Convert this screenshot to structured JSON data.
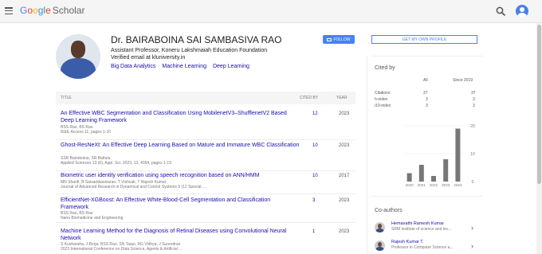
{
  "header": {
    "logo_letters": [
      "G",
      "o",
      "o",
      "g",
      "l",
      "e"
    ],
    "logo_product": "Scholar"
  },
  "profile": {
    "name": "Dr. BAIRABOINA SAI SAMBASIVA RAO",
    "affiliation": "Assistant Professor, Koneru Lakshmaiah Education Foundation",
    "email": "Verified email at kluniversity.in",
    "interests": [
      "Big Data Analytics",
      "Machine Learning",
      "Deep Learning"
    ],
    "follow_label": "FOLLOW",
    "my_profile_label": "GET MY OWN PROFILE"
  },
  "table": {
    "headers": {
      "title": "TITLE",
      "cited_by": "CITED BY",
      "year": "YEAR"
    },
    "rows": [
      {
        "title": "An Effective WBC Segmentation and Classification Using MobilenetV3–ShufflenetV2 Based Deep Learning Framework",
        "authors": "BSS Rao, BS Rao",
        "venue": "IEEE Access 11, pages 1-10",
        "cited": "12",
        "year": "2023"
      },
      {
        "title": "Ghost-ResNeXt: An Effective Deep Learning Based on Mature and Immature WBC Classification",
        "authors": "SSR Bairaboina, SR Battula",
        "venue": "Applied Sciences 13 (6), Appl. Sci. 2023, 13, 4054, pages 1-19",
        "cited": "10",
        "year": "2023"
      },
      {
        "title": "Biometric user identity verification using speech recognition based on ANN/HMM",
        "authors": "MN Sharifi, B Saisambasivarao, T Vishvak, T Rajesh Kumar",
        "venue": "Journal of Advanced Research in Dynamical and Control Systems 9 (12 Special ...",
        "cited": "10",
        "year": "2017"
      },
      {
        "title": "EfficientNet-XGBoost: An Effective White-Blood-Cell Segmentation and Classification Framework",
        "authors": "BSS Rao, BS Rao",
        "venue": "Nano Biomedicine and Engineering",
        "cited": "3",
        "year": "2023"
      },
      {
        "title": "Machine Learning Method for the Diagnosis of Retinal Diseases using Convolutional Neural Network",
        "authors": "S Kusharaha, J Borja, BSS Rao, SN Taqui, RG Vidhya, J Surendran",
        "venue": "2023 International Conference on Data Science, Agents & Artificial ...",
        "cited": "1",
        "year": "2023"
      }
    ]
  },
  "cited_by": {
    "title": "Cited by",
    "col_all": "All",
    "col_since": "Since 2019",
    "rows": [
      {
        "label": "Citations",
        "all": "37",
        "since": "37"
      },
      {
        "label": "h-index",
        "all": "3",
        "since": "3"
      },
      {
        "label": "i10-index",
        "all": "3",
        "since": "3"
      }
    ]
  },
  "chart_data": {
    "type": "bar",
    "categories": [
      "2020",
      "2021",
      "2022",
      "2023",
      "2024"
    ],
    "values": [
      3,
      6,
      2,
      8,
      19
    ],
    "yticks": [
      "20",
      "10",
      "0"
    ],
    "ylim": [
      0,
      20
    ],
    "bar_color": "#777777"
  },
  "coauthors": {
    "title": "Co-authors",
    "items": [
      {
        "name": "Hemavathi Ramesh Kumar",
        "affiliation": "SRM institute of science and tec..."
      },
      {
        "name": "Rajesh Kumar T.",
        "affiliation": "Professor in Computer Science a..."
      }
    ]
  },
  "colors": {
    "link": "#1a0dab",
    "accent": "#4285f4"
  }
}
